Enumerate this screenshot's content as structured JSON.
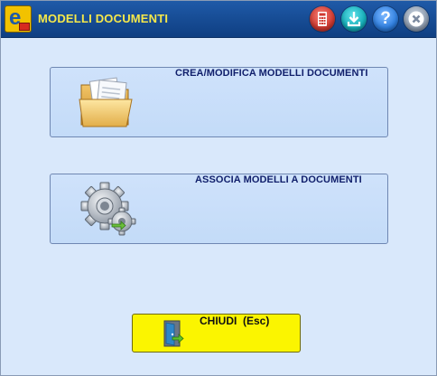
{
  "window": {
    "title": "MODELLI DOCUMENTI",
    "app_logo_letter": "e"
  },
  "titlebar_buttons": [
    {
      "name": "calculator",
      "icon": "calculator-icon"
    },
    {
      "name": "download",
      "icon": "download-icon"
    },
    {
      "name": "help",
      "icon": "help-icon",
      "glyph": "?"
    },
    {
      "name": "close",
      "icon": "close-icon"
    }
  ],
  "actions": {
    "edit_templates": {
      "label": "CREA/MODIFICA MODELLI DOCUMENTI",
      "icon": "folder-icon"
    },
    "associate_templates": {
      "label": "ASSOCIA MODELLI A DOCUMENTI",
      "icon": "gears-icon"
    }
  },
  "close_button": {
    "label": "CHIUDI  (Esc)",
    "icon": "exit-door-icon"
  },
  "colors": {
    "titlebar": "#164b93",
    "title_text": "#f6e84a",
    "background": "#d9e8fb",
    "action_button": "#c3dbf8",
    "action_text": "#101f6b",
    "close_button": "#fbf500"
  }
}
